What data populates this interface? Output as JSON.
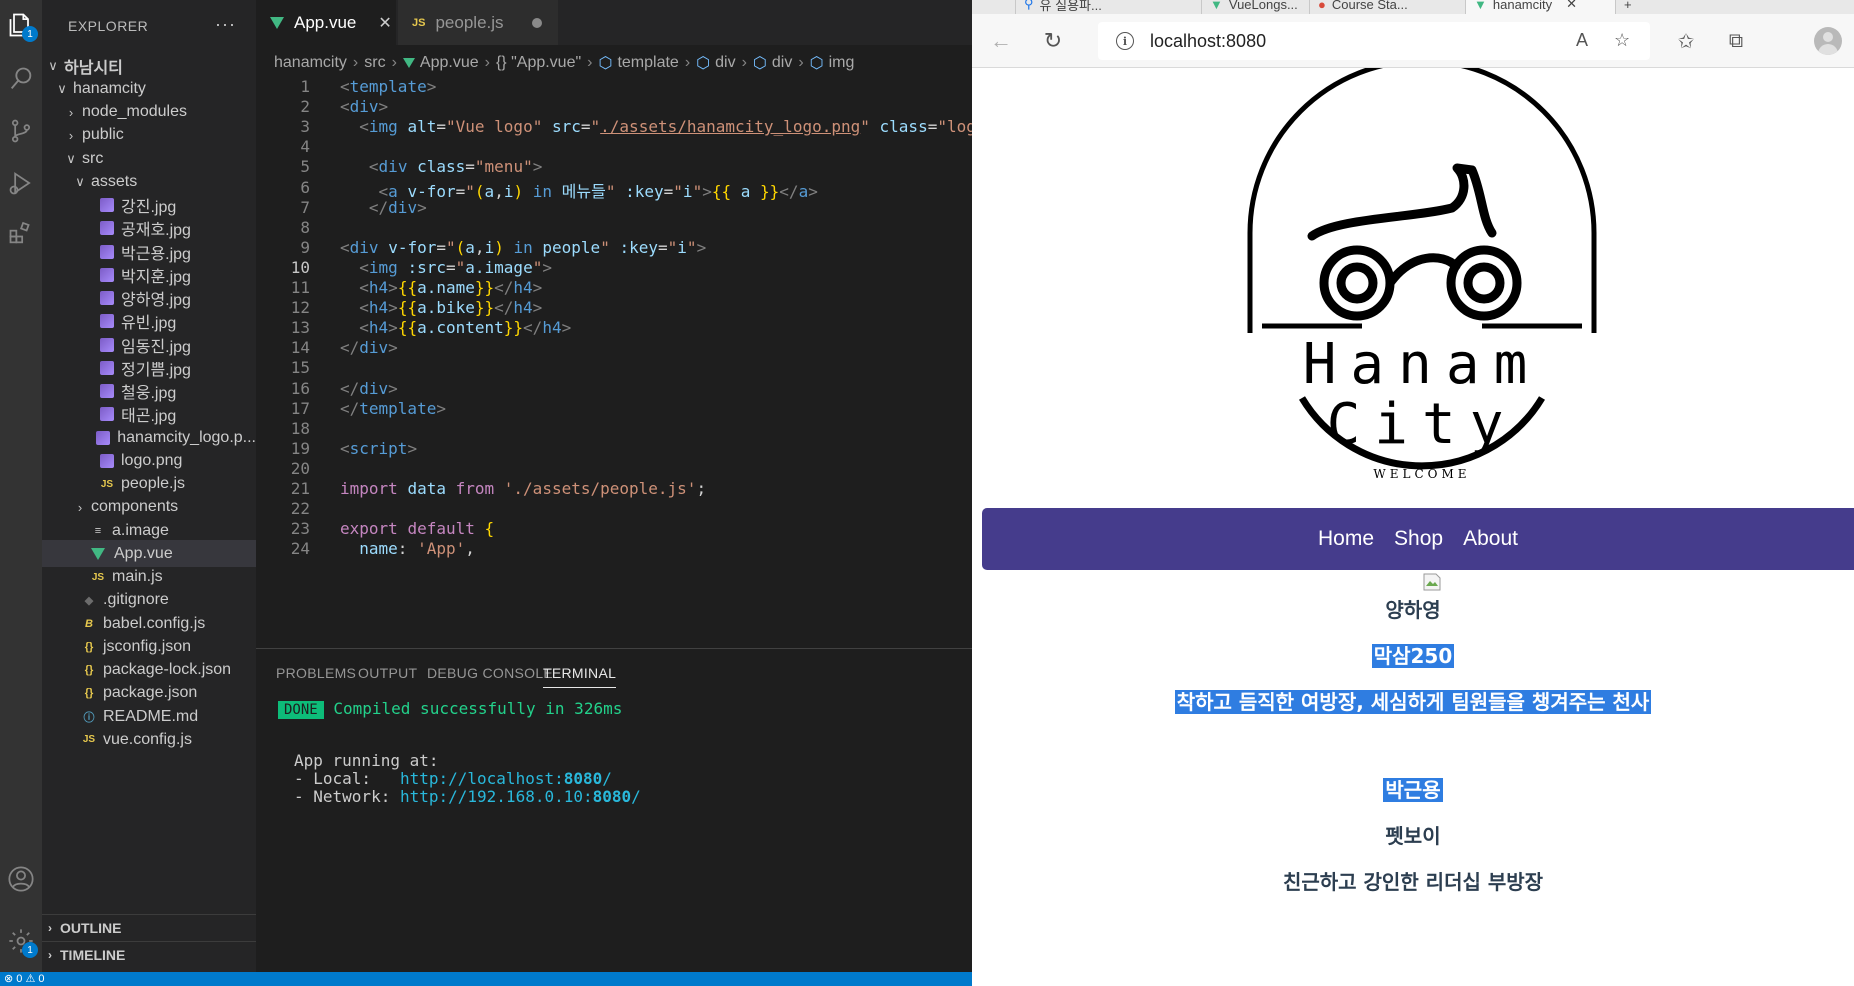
{
  "vscode": {
    "activity_badges": {
      "explorer": "1",
      "settings": "1"
    },
    "explorer_title": "EXPLORER",
    "explorer_more": "···",
    "tree": [
      {
        "label": "하남시티",
        "kind": "root",
        "chev": "∨",
        "icon": ""
      },
      {
        "label": "hanamcity",
        "kind": "folder",
        "chev": "∨",
        "icon": ""
      },
      {
        "label": "node_modules",
        "kind": "folder",
        "chev": "›",
        "icon": ""
      },
      {
        "label": "public",
        "kind": "folder",
        "chev": "›",
        "icon": ""
      },
      {
        "label": "src",
        "kind": "folder",
        "chev": "∨",
        "icon": ""
      },
      {
        "label": "assets",
        "kind": "folder",
        "chev": "∨",
        "icon": ""
      },
      {
        "label": "강진.jpg",
        "kind": "file",
        "icon": "image-file-icon"
      },
      {
        "label": "공재호.jpg",
        "kind": "file",
        "icon": "image-file-icon"
      },
      {
        "label": "박근용.jpg",
        "kind": "file",
        "icon": "image-file-icon"
      },
      {
        "label": "박지훈.jpg",
        "kind": "file",
        "icon": "image-file-icon"
      },
      {
        "label": "양하영.jpg",
        "kind": "file",
        "icon": "image-file-icon"
      },
      {
        "label": "유빈.jpg",
        "kind": "file",
        "icon": "image-file-icon"
      },
      {
        "label": "임동진.jpg",
        "kind": "file",
        "icon": "image-file-icon"
      },
      {
        "label": "정기쁨.jpg",
        "kind": "file",
        "icon": "image-file-icon"
      },
      {
        "label": "철웅.jpg",
        "kind": "file",
        "icon": "image-file-icon"
      },
      {
        "label": "태곤.jpg",
        "kind": "file",
        "icon": "image-file-icon"
      },
      {
        "label": "hanamcity_logo.p...",
        "kind": "file",
        "icon": "image-file-icon"
      },
      {
        "label": "logo.png",
        "kind": "file",
        "icon": "image-file-icon"
      },
      {
        "label": "people.js",
        "kind": "file",
        "icon": "js-file-icon"
      },
      {
        "label": "components",
        "kind": "folder",
        "chev": "›",
        "icon": ""
      },
      {
        "label": "a.image",
        "kind": "file",
        "icon": "text-file-icon"
      },
      {
        "label": "App.vue",
        "kind": "file",
        "icon": "vue-file-icon",
        "selected": true
      },
      {
        "label": "main.js",
        "kind": "file",
        "icon": "js-file-icon"
      },
      {
        "label": ".gitignore",
        "kind": "file",
        "icon": "git-file-icon"
      },
      {
        "label": "babel.config.js",
        "kind": "file",
        "icon": "babel-file-icon"
      },
      {
        "label": "jsconfig.json",
        "kind": "file",
        "icon": "json-file-icon"
      },
      {
        "label": "package-lock.json",
        "kind": "file",
        "icon": "json-file-icon"
      },
      {
        "label": "package.json",
        "kind": "file",
        "icon": "json-file-icon"
      },
      {
        "label": "README.md",
        "kind": "file",
        "icon": "info-file-icon"
      },
      {
        "label": "vue.config.js",
        "kind": "file",
        "icon": "js-file-icon"
      }
    ],
    "sections": {
      "outline": "OUTLINE",
      "timeline": "TIMELINE"
    },
    "tabs": {
      "app": "App.vue",
      "people": "people.js"
    },
    "breadcrumbs": [
      "hanamcity",
      "src",
      "App.vue",
      "{} \"App.vue\"",
      "template",
      "div",
      "div",
      "img"
    ],
    "panel_tabs": [
      "PROBLEMS",
      "OUTPUT",
      "DEBUG CONSOLE",
      "TERMINAL"
    ],
    "terminal": {
      "done": "DONE",
      "compiled": "Compiled successfully in 326ms",
      "running": "App running at:",
      "local_label": "- Local:   ",
      "local_url_pre": "http://localhost:",
      "local_url_port": "8080",
      "local_url_post": "/",
      "network_label": "- Network: ",
      "network_url_pre": "http://192.168.0.10:",
      "network_url_port": "8080",
      "network_url_post": "/"
    },
    "status": "⊗ 0 ⚠ 0"
  },
  "code": [
    {
      "n": "1",
      "tokens": [
        [
          "t-br",
          "<"
        ],
        [
          "t-tag",
          "template"
        ],
        [
          "t-br",
          ">"
        ]
      ]
    },
    {
      "n": "2",
      "tokens": [
        [
          "t-br",
          "<"
        ],
        [
          "t-tag",
          "div"
        ],
        [
          "t-br",
          ">"
        ]
      ]
    },
    {
      "n": "3",
      "tokens": [
        [
          "t-op",
          "  "
        ],
        [
          "t-br",
          "<"
        ],
        [
          "t-tag",
          "img"
        ],
        [
          "t-op",
          " "
        ],
        [
          "t-attr",
          "alt"
        ],
        [
          "t-op",
          "="
        ],
        [
          "t-str",
          "\"Vue logo\""
        ],
        [
          "t-op",
          " "
        ],
        [
          "t-attr",
          "src"
        ],
        [
          "t-op",
          "="
        ],
        [
          "t-str",
          "\""
        ],
        [
          "t-url",
          "./assets/hanamcity_logo.png"
        ],
        [
          "t-str",
          "\""
        ],
        [
          "t-op",
          " "
        ],
        [
          "t-attr",
          "class"
        ],
        [
          "t-op",
          "="
        ],
        [
          "t-str",
          "\"logo\""
        ]
      ]
    },
    {
      "n": "4",
      "tokens": []
    },
    {
      "n": "5",
      "tokens": [
        [
          "t-op",
          "   "
        ],
        [
          "t-br",
          "<"
        ],
        [
          "t-tag",
          "div"
        ],
        [
          "t-op",
          " "
        ],
        [
          "t-attr",
          "class"
        ],
        [
          "t-op",
          "="
        ],
        [
          "t-str",
          "\"menu\""
        ],
        [
          "t-br",
          ">"
        ]
      ]
    },
    {
      "n": "6",
      "tokens": [
        [
          "t-op",
          "    "
        ],
        [
          "t-br",
          "<"
        ],
        [
          "t-tag",
          "a"
        ],
        [
          "t-op",
          " "
        ],
        [
          "t-attr",
          "v-for"
        ],
        [
          "t-op",
          "="
        ],
        [
          "t-str",
          "\""
        ],
        [
          "t-gold",
          "("
        ],
        [
          "t-var",
          "a"
        ],
        [
          "t-op",
          ","
        ],
        [
          "t-var",
          "i"
        ],
        [
          "t-gold",
          ")"
        ],
        [
          "t-op",
          " "
        ],
        [
          "t-kw2",
          "in"
        ],
        [
          "t-op",
          " "
        ],
        [
          "t-var",
          "메뉴들"
        ],
        [
          "t-str",
          "\""
        ],
        [
          "t-op",
          " "
        ],
        [
          "t-attr",
          ":key"
        ],
        [
          "t-op",
          "="
        ],
        [
          "t-str",
          "\""
        ],
        [
          "t-var",
          "i"
        ],
        [
          "t-str",
          "\""
        ],
        [
          "t-br",
          ">"
        ],
        [
          "t-gold",
          "{{"
        ],
        [
          "t-op",
          " "
        ],
        [
          "t-var",
          "a"
        ],
        [
          "t-op",
          " "
        ],
        [
          "t-gold",
          "}}"
        ],
        [
          "t-br",
          "</"
        ],
        [
          "t-tag",
          "a"
        ],
        [
          "t-br",
          ">"
        ]
      ]
    },
    {
      "n": "7",
      "tokens": [
        [
          "t-op",
          "   "
        ],
        [
          "t-br",
          "</"
        ],
        [
          "t-tag",
          "div"
        ],
        [
          "t-br",
          ">"
        ]
      ]
    },
    {
      "n": "8",
      "tokens": []
    },
    {
      "n": "9",
      "tokens": [
        [
          "t-br",
          "<"
        ],
        [
          "t-tag",
          "div"
        ],
        [
          "t-op",
          " "
        ],
        [
          "t-attr",
          "v-for"
        ],
        [
          "t-op",
          "="
        ],
        [
          "t-str",
          "\""
        ],
        [
          "t-gold",
          "("
        ],
        [
          "t-var",
          "a"
        ],
        [
          "t-op",
          ","
        ],
        [
          "t-var",
          "i"
        ],
        [
          "t-gold",
          ")"
        ],
        [
          "t-op",
          " "
        ],
        [
          "t-kw2",
          "in"
        ],
        [
          "t-op",
          " "
        ],
        [
          "t-var",
          "people"
        ],
        [
          "t-str",
          "\""
        ],
        [
          "t-op",
          " "
        ],
        [
          "t-attr",
          ":key"
        ],
        [
          "t-op",
          "="
        ],
        [
          "t-str",
          "\""
        ],
        [
          "t-var",
          "i"
        ],
        [
          "t-str",
          "\""
        ],
        [
          "t-br",
          ">"
        ]
      ]
    },
    {
      "n": "10",
      "tokens": [
        [
          "t-op",
          "  "
        ],
        [
          "t-br",
          "<"
        ],
        [
          "t-tag",
          "img"
        ],
        [
          "t-op",
          " "
        ],
        [
          "t-attr",
          ":src"
        ],
        [
          "t-op",
          "="
        ],
        [
          "t-str",
          "\""
        ],
        [
          "t-var",
          "a.image"
        ],
        [
          "t-str",
          "\""
        ],
        [
          "t-br",
          ">"
        ]
      ]
    },
    {
      "n": "11",
      "tokens": [
        [
          "t-op",
          "  "
        ],
        [
          "t-br",
          "<"
        ],
        [
          "t-tag",
          "h4"
        ],
        [
          "t-br",
          ">"
        ],
        [
          "t-gold",
          "{{"
        ],
        [
          "t-var",
          "a.name"
        ],
        [
          "t-gold",
          "}}"
        ],
        [
          "t-br",
          "</"
        ],
        [
          "t-tag",
          "h4"
        ],
        [
          "t-br",
          ">"
        ]
      ]
    },
    {
      "n": "12",
      "tokens": [
        [
          "t-op",
          "  "
        ],
        [
          "t-br",
          "<"
        ],
        [
          "t-tag",
          "h4"
        ],
        [
          "t-br",
          ">"
        ],
        [
          "t-gold",
          "{{"
        ],
        [
          "t-var",
          "a.bike"
        ],
        [
          "t-gold",
          "}}"
        ],
        [
          "t-br",
          "</"
        ],
        [
          "t-tag",
          "h4"
        ],
        [
          "t-br",
          ">"
        ]
      ]
    },
    {
      "n": "13",
      "tokens": [
        [
          "t-op",
          "  "
        ],
        [
          "t-br",
          "<"
        ],
        [
          "t-tag",
          "h4"
        ],
        [
          "t-br",
          ">"
        ],
        [
          "t-gold",
          "{{"
        ],
        [
          "t-var",
          "a.content"
        ],
        [
          "t-gold",
          "}}"
        ],
        [
          "t-br",
          "</"
        ],
        [
          "t-tag",
          "h4"
        ],
        [
          "t-br",
          ">"
        ]
      ]
    },
    {
      "n": "14",
      "tokens": [
        [
          "t-br",
          "</"
        ],
        [
          "t-tag",
          "div"
        ],
        [
          "t-br",
          ">"
        ]
      ]
    },
    {
      "n": "15",
      "tokens": []
    },
    {
      "n": "16",
      "tokens": [
        [
          "t-br",
          "</"
        ],
        [
          "t-tag",
          "div"
        ],
        [
          "t-br",
          ">"
        ]
      ]
    },
    {
      "n": "17",
      "tokens": [
        [
          "t-br",
          "</"
        ],
        [
          "t-tag",
          "template"
        ],
        [
          "t-br",
          ">"
        ]
      ]
    },
    {
      "n": "18",
      "tokens": []
    },
    {
      "n": "19",
      "tokens": [
        [
          "t-br",
          "<"
        ],
        [
          "t-tag",
          "script"
        ],
        [
          "t-br",
          ">"
        ]
      ]
    },
    {
      "n": "20",
      "tokens": []
    },
    {
      "n": "21",
      "tokens": [
        [
          "t-kw",
          "import"
        ],
        [
          "t-op",
          " "
        ],
        [
          "t-var",
          "data"
        ],
        [
          "t-op",
          " "
        ],
        [
          "t-kw",
          "from"
        ],
        [
          "t-op",
          " "
        ],
        [
          "t-str",
          "'./assets/people.js'"
        ],
        [
          "t-op",
          ";"
        ]
      ]
    },
    {
      "n": "22",
      "tokens": []
    },
    {
      "n": "23",
      "tokens": [
        [
          "t-kw",
          "export"
        ],
        [
          "t-op",
          " "
        ],
        [
          "t-kw",
          "default"
        ],
        [
          "t-op",
          " "
        ],
        [
          "t-gold",
          "{"
        ]
      ]
    },
    {
      "n": "24",
      "tokens": [
        [
          "t-op",
          "  "
        ],
        [
          "t-prop",
          "name"
        ],
        [
          "t-op",
          ": "
        ],
        [
          "t-str",
          "'App'"
        ],
        [
          "t-op",
          ","
        ]
      ]
    }
  ],
  "browser": {
    "tabs": [
      "",
      "유 실용파...",
      "VueLongs...",
      "Course Sta...",
      "hanamcity",
      "+"
    ],
    "url": "localhost:8080",
    "logo_line1": "Hanam",
    "logo_line2": "City",
    "logo_welcome": "WELCOME",
    "menu": [
      "Home",
      "Shop",
      "About"
    ],
    "people": [
      {
        "name": "양하영",
        "bike": "막삼250",
        "content": "착하고 듬직한 여방장, 세심하게 팀원들을 챙겨주는 천사"
      },
      {
        "name": "박근용",
        "bike": "펫보이",
        "content": "친근하고 강인한 리더십 부방장"
      }
    ],
    "selection_color": "#2f7de1",
    "nav_color": "#453c8c"
  }
}
